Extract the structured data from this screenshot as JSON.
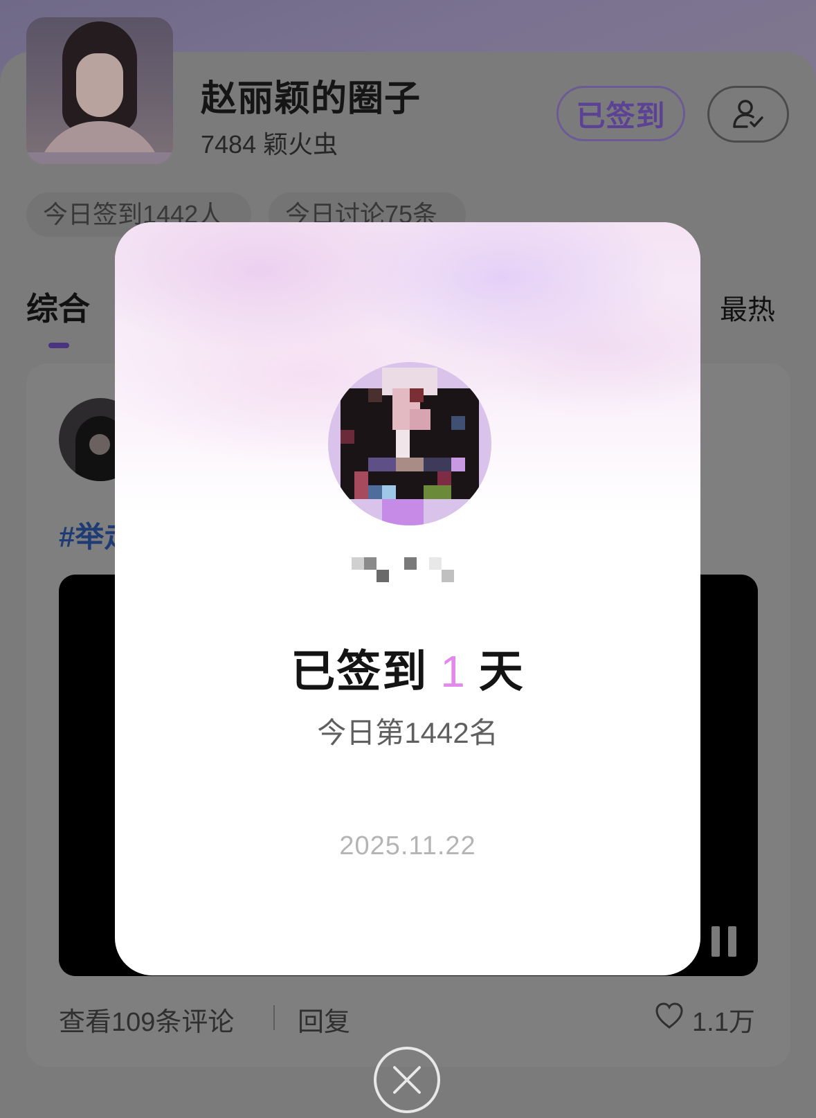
{
  "circle": {
    "title": "赵丽颖的圈子",
    "members": "7484 颖火虫",
    "signed_label": "已签到",
    "stats": [
      "今日签到1442人",
      "今日讨论75条"
    ]
  },
  "tabs": {
    "main": "综合",
    "hot": "最热"
  },
  "post": {
    "hashtag": "#举走",
    "comments": "查看109条评论",
    "reply": "回复",
    "likes": "1.1万"
  },
  "modal": {
    "streak_prefix": "已签到",
    "streak_days": "1",
    "streak_suffix": "天",
    "rank": "今日第1442名",
    "date": "2025.11.22"
  },
  "colors": {
    "accent": "#5b4295",
    "streak_number": "#e489ec"
  },
  "icons": [
    "user-check-icon",
    "heart-icon",
    "pause-icon",
    "close-icon"
  ]
}
